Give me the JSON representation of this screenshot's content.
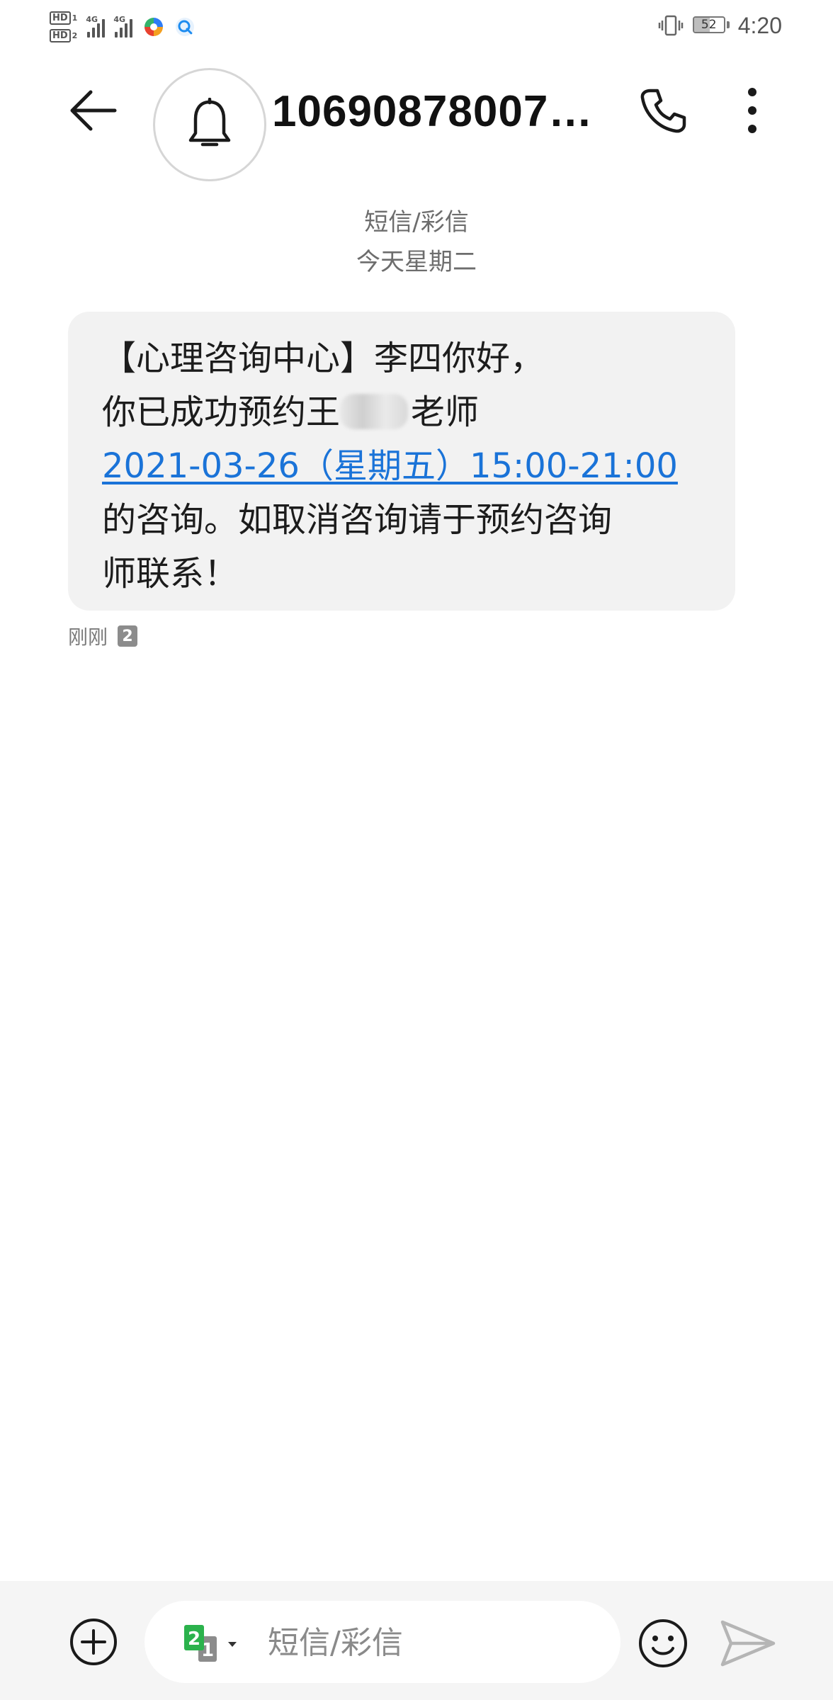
{
  "status_bar": {
    "sim1_label": "HD",
    "sim1_index": "1",
    "sim2_label": "HD",
    "sim2_index": "2",
    "network1": "4G",
    "network2": "4G",
    "battery_level": "52",
    "time": "4:20"
  },
  "header": {
    "contact": "106908780076...",
    "back_icon": "arrow-left-icon",
    "avatar_icon": "bell-icon",
    "call_icon": "phone-icon",
    "more_icon": "more-vertical-icon"
  },
  "conversation": {
    "channel": "短信/彩信",
    "date": "今天星期二"
  },
  "message": {
    "line1": "【心理咨询中心】李四你好，",
    "line2_before": "你已成功预约王",
    "line2_after": "老师",
    "link": "2021-03-26（星期五）15:00-21:00",
    "line4": "的咨询。如取消咨询请于预约咨询",
    "line5": "师联系！",
    "time": "刚刚",
    "sim": "2",
    "link_color": "#1a73d8",
    "bubble_color": "#f2f2f2"
  },
  "compose": {
    "placeholder": "短信/彩信",
    "sim_primary": "2",
    "sim_secondary": "1",
    "sim_color": "#2bb24c",
    "add_icon": "plus-circle-icon",
    "emoji_icon": "smiley-icon",
    "send_icon": "send-icon"
  }
}
